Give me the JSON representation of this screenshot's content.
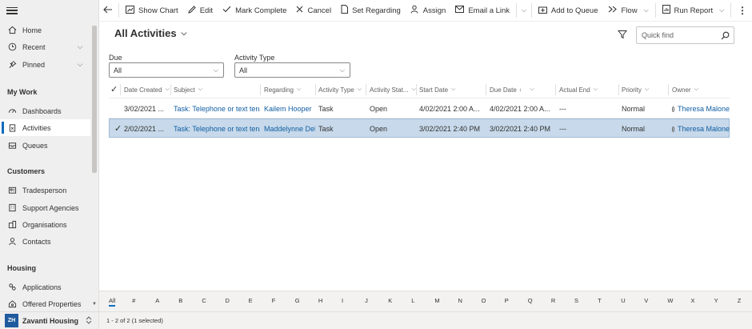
{
  "sidebar": {
    "items": [
      {
        "label": "Home",
        "icon": "home-icon"
      },
      {
        "label": "Recent",
        "icon": "clock-icon"
      },
      {
        "label": "Pinned",
        "icon": "pin-icon"
      }
    ],
    "sections": [
      {
        "title": "My Work",
        "items": [
          {
            "label": "Dashboards",
            "icon": "dashboard-icon"
          },
          {
            "label": "Activities",
            "icon": "clipboard-icon",
            "selected": true
          },
          {
            "label": "Queues",
            "icon": "queue-icon"
          }
        ]
      },
      {
        "title": "Customers",
        "items": [
          {
            "label": "Tradesperson",
            "icon": "contact-card-icon"
          },
          {
            "label": "Support Agencies",
            "icon": "building-icon"
          },
          {
            "label": "Organisations",
            "icon": "organisation-icon"
          },
          {
            "label": "Contacts",
            "icon": "person-icon"
          }
        ]
      },
      {
        "title": "Housing",
        "items": [
          {
            "label": "Applications",
            "icon": "application-icon"
          },
          {
            "label": "Offered Properties",
            "icon": "property-icon"
          }
        ]
      }
    ],
    "area": {
      "initials": "ZH",
      "label": "Zavanti Housing"
    }
  },
  "commandbar": {
    "show_chart": "Show Chart",
    "edit": "Edit",
    "mark_complete": "Mark Complete",
    "cancel": "Cancel",
    "set_regarding": "Set Regarding",
    "assign": "Assign",
    "email_link": "Email a Link",
    "add_to_queue": "Add to Queue",
    "flow": "Flow",
    "run_report": "Run Report"
  },
  "view": {
    "title": "All Activities",
    "search_placeholder": "Quick find"
  },
  "filters": {
    "due_label": "Due",
    "due_value": "All",
    "type_label": "Activity Type",
    "type_value": "All"
  },
  "grid": {
    "headers": {
      "date_created": "Date Created",
      "subject": "Subject",
      "regarding": "Regarding",
      "activity_type": "Activity Type",
      "activity_status": "Activity Stat...",
      "start_date": "Start Date",
      "due_date": "Due Date",
      "actual_end": "Actual End",
      "priority": "Priority",
      "owner": "Owner"
    },
    "rows": [
      {
        "date_created": "3/02/2021 ...",
        "subject": "Task: Telephone or text tenar",
        "regarding": "Kailem Hooper",
        "activity_type": "Task",
        "activity_status": "Open",
        "start_date": "4/02/2021 2:00 A...",
        "due_date": "4/02/2021 2:00 A...",
        "actual_end": "---",
        "priority": "Normal",
        "owner": "Theresa Malone"
      },
      {
        "date_created": "2/02/2021 ...",
        "subject": "Task: Telephone or text tenar",
        "regarding": "Maddelynne Deb",
        "activity_type": "Task",
        "activity_status": "Open",
        "start_date": "3/02/2021 2:40 PM",
        "due_date": "3/02/2021 2:40 PM",
        "actual_end": "---",
        "priority": "Normal",
        "owner": "Theresa Malone"
      }
    ]
  },
  "jumpbar": [
    "All",
    "#",
    "A",
    "B",
    "C",
    "D",
    "E",
    "F",
    "G",
    "H",
    "I",
    "J",
    "K",
    "L",
    "M",
    "N",
    "O",
    "P",
    "Q",
    "R",
    "S",
    "T",
    "U",
    "V",
    "W",
    "X",
    "Y",
    "Z"
  ],
  "status": {
    "text": "1 - 2 of 2 (1 selected)"
  },
  "colors": {
    "accent": "#0f6cbd",
    "link": "#115ea3",
    "selected_row": "#c7d9ea"
  }
}
